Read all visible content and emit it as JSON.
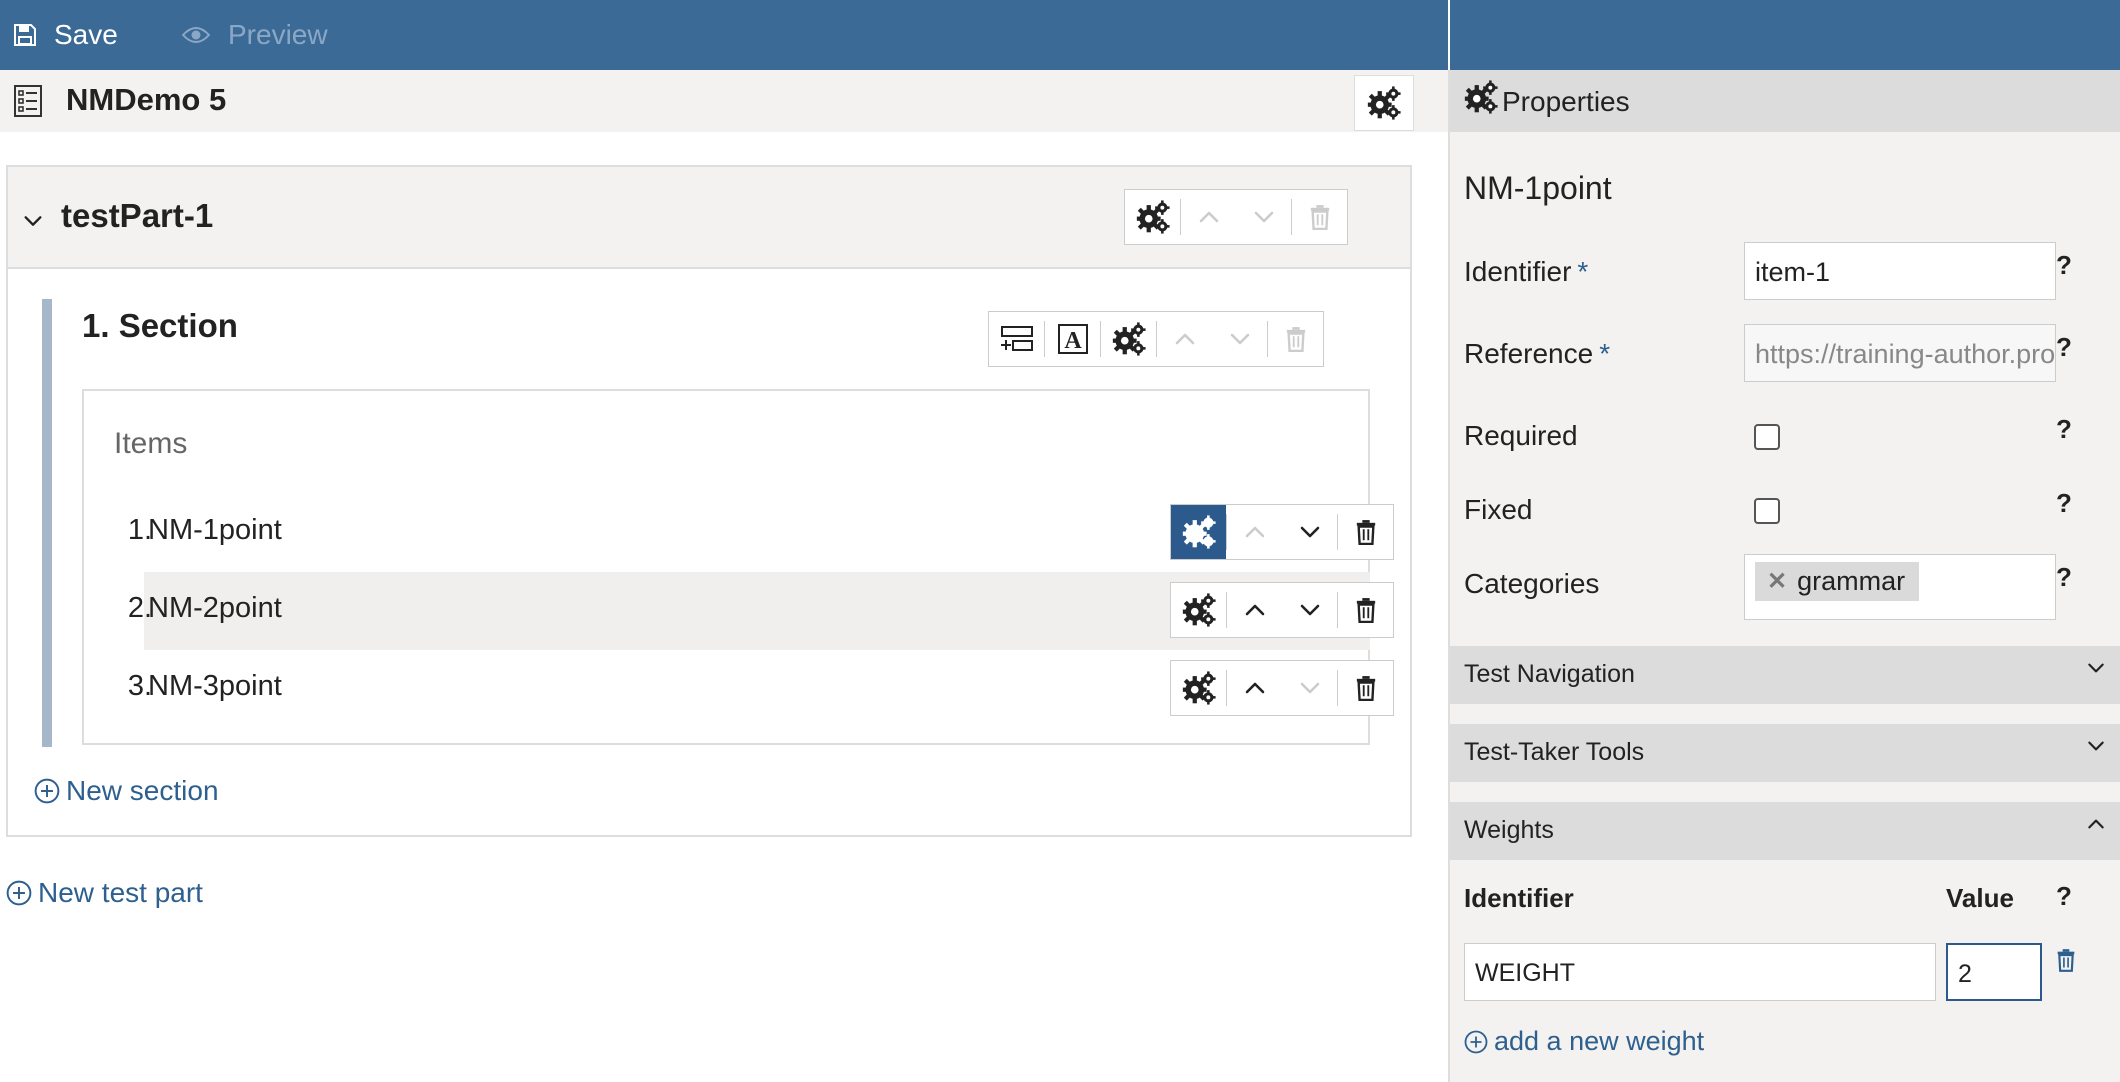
{
  "toolbar": {
    "save_label": "Save",
    "preview_label": "Preview",
    "save_icon": "floppy-disk-icon",
    "preview_icon": "eye-icon"
  },
  "test": {
    "title": "NMDemo 5"
  },
  "test_part": {
    "title": "testPart-1",
    "section": {
      "title": "1. Section",
      "items_label": "Items",
      "items": [
        {
          "num": "1.",
          "name": "NM-1point"
        },
        {
          "num": "2.",
          "name": "NM-2point"
        },
        {
          "num": "3.",
          "name": "NM-3point"
        }
      ]
    },
    "new_section_label": "New section"
  },
  "new_test_part_label": "New test part",
  "properties": {
    "header": "Properties",
    "object_title": "NM-1point",
    "identifier": {
      "label": "Identifier",
      "required_mark": "*",
      "value": "item-1",
      "help": "?"
    },
    "reference": {
      "label": "Reference",
      "required_mark": "*",
      "value": "https://training-author.pro",
      "help": "?"
    },
    "required": {
      "label": "Required",
      "checked": false,
      "help": "?"
    },
    "fixed": {
      "label": "Fixed",
      "checked": false,
      "help": "?"
    },
    "categories": {
      "label": "Categories",
      "tags": [
        "grammar"
      ],
      "help": "?"
    },
    "sections": [
      {
        "title": "Test Navigation",
        "expanded": false
      },
      {
        "title": "Test-Taker Tools",
        "expanded": false
      },
      {
        "title": "Weights",
        "expanded": true
      }
    ],
    "weights": {
      "identifier_header": "Identifier",
      "value_header": "Value",
      "help": "?",
      "rows": [
        {
          "identifier": "WEIGHT",
          "value": "2"
        }
      ],
      "add_label": "add a new weight"
    }
  },
  "colors": {
    "topbar": "#3c6a97",
    "accent": "#2d5a8c",
    "link": "#2d5f8f",
    "panel_bg": "#f3f2f1"
  }
}
